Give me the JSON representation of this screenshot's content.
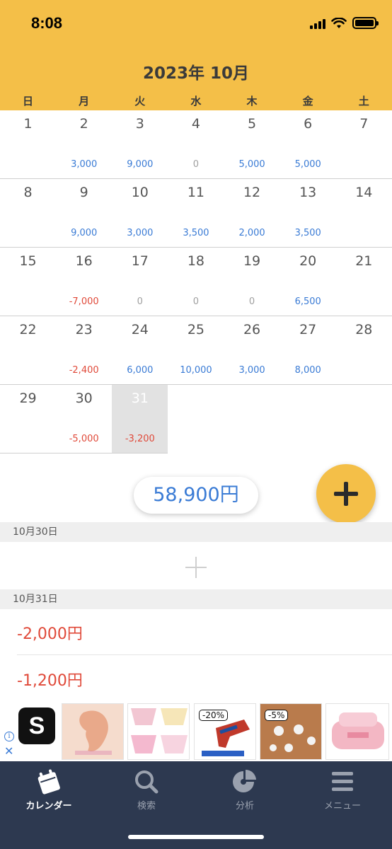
{
  "status_bar": {
    "time": "8:08"
  },
  "header": {
    "month_title": "2023年 10月",
    "weekdays": [
      "日",
      "月",
      "火",
      "水",
      "木",
      "金",
      "土"
    ]
  },
  "calendar": {
    "weeks": [
      [
        {
          "day": "1",
          "amount": ""
        },
        {
          "day": "2",
          "amount": "3,000",
          "kind": "pos"
        },
        {
          "day": "3",
          "amount": "9,000",
          "kind": "pos"
        },
        {
          "day": "4",
          "amount": "0",
          "kind": "zero"
        },
        {
          "day": "5",
          "amount": "5,000",
          "kind": "pos"
        },
        {
          "day": "6",
          "amount": "5,000",
          "kind": "pos"
        },
        {
          "day": "7",
          "amount": ""
        }
      ],
      [
        {
          "day": "8",
          "amount": ""
        },
        {
          "day": "9",
          "amount": "9,000",
          "kind": "pos"
        },
        {
          "day": "10",
          "amount": "3,000",
          "kind": "pos"
        },
        {
          "day": "11",
          "amount": "3,500",
          "kind": "pos"
        },
        {
          "day": "12",
          "amount": "2,000",
          "kind": "pos"
        },
        {
          "day": "13",
          "amount": "3,500",
          "kind": "pos"
        },
        {
          "day": "14",
          "amount": ""
        }
      ],
      [
        {
          "day": "15",
          "amount": ""
        },
        {
          "day": "16",
          "amount": "-7,000",
          "kind": "neg"
        },
        {
          "day": "17",
          "amount": "0",
          "kind": "zero"
        },
        {
          "day": "18",
          "amount": "0",
          "kind": "zero"
        },
        {
          "day": "19",
          "amount": "0",
          "kind": "zero"
        },
        {
          "day": "20",
          "amount": "6,500",
          "kind": "pos"
        },
        {
          "day": "21",
          "amount": ""
        }
      ],
      [
        {
          "day": "22",
          "amount": ""
        },
        {
          "day": "23",
          "amount": "-2,400",
          "kind": "neg"
        },
        {
          "day": "24",
          "amount": "6,000",
          "kind": "pos"
        },
        {
          "day": "25",
          "amount": "10,000",
          "kind": "pos"
        },
        {
          "day": "26",
          "amount": "3,000",
          "kind": "pos"
        },
        {
          "day": "27",
          "amount": "8,000",
          "kind": "pos"
        },
        {
          "day": "28",
          "amount": ""
        }
      ],
      [
        {
          "day": "29",
          "amount": ""
        },
        {
          "day": "30",
          "amount": "-5,000",
          "kind": "neg"
        },
        {
          "day": "31",
          "amount": "-3,200",
          "kind": "neg",
          "selected": true
        }
      ]
    ]
  },
  "summary": {
    "total": "58,900円"
  },
  "sections": [
    {
      "date": "10月30日",
      "entries": []
    },
    {
      "date": "10月31日",
      "entries": [
        "-2,000円",
        "-1,200円"
      ]
    }
  ],
  "ad": {
    "logo_letter": "S",
    "info_icon": "i",
    "close_icon": "✕",
    "badges": [
      "-20%",
      "-5%"
    ]
  },
  "tabbar": {
    "tabs": [
      {
        "label": "カレンダー",
        "icon": "calendar-icon",
        "active": true
      },
      {
        "label": "検索",
        "icon": "search-icon"
      },
      {
        "label": "分析",
        "icon": "pie-chart-icon"
      },
      {
        "label": "メニュー",
        "icon": "menu-icon"
      }
    ]
  },
  "colors": {
    "accent": "#f4bf48",
    "positive": "#3a7bd5",
    "negative": "#e04a3a",
    "tabbar": "#2d3950"
  }
}
